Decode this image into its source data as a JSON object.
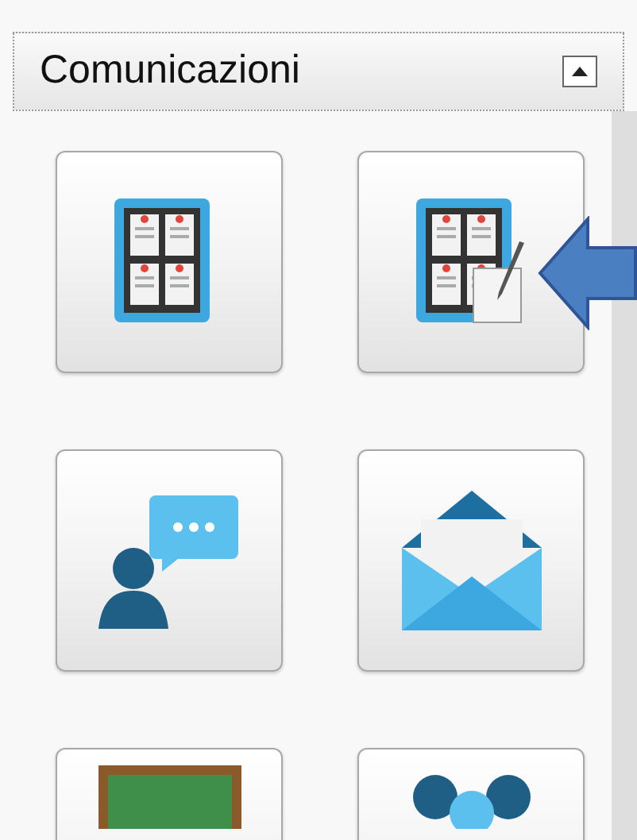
{
  "panel": {
    "title": "Comunicazioni",
    "expanded": true
  }
}
